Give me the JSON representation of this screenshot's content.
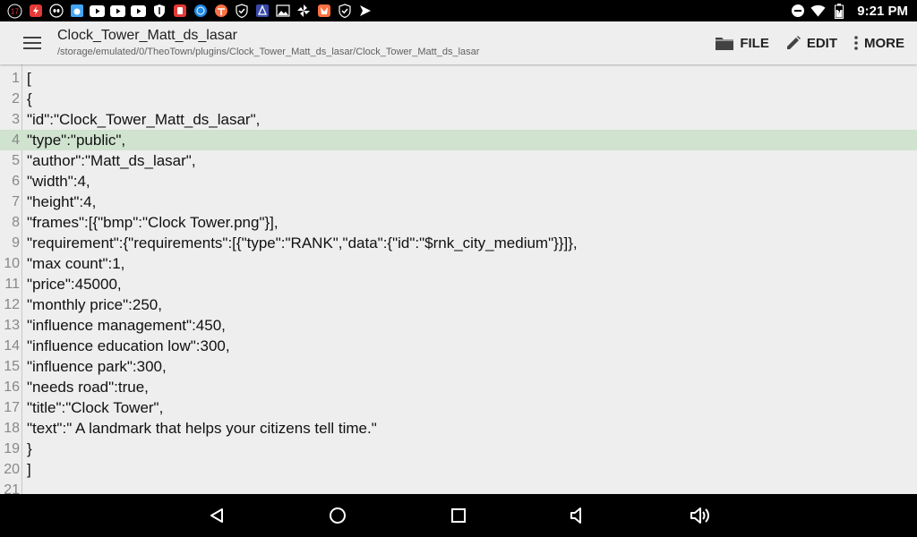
{
  "status_bar": {
    "notification_count": "17",
    "time": "9:21 PM",
    "left_icons": [
      "notification-count-icon",
      "flash-icon",
      "alien-icon",
      "weather-icon",
      "youtube-icon",
      "youtube-icon",
      "youtube-icon",
      "shield-icon",
      "app-icon",
      "globe-icon",
      "vpn-icon",
      "check-shield-icon",
      "astro-icon",
      "image-icon",
      "pinwheel-icon",
      "fox-icon",
      "check-shield-icon",
      "send-icon"
    ],
    "right_icons": [
      "dnd-icon",
      "wifi-icon",
      "battery-icon"
    ]
  },
  "app_bar": {
    "title": "Clock_Tower_Matt_ds_lasar",
    "path": "/storage/emulated/0/TheoTown/plugins/Clock_Tower_Matt_ds_lasar/Clock_Tower_Matt_ds_lasar",
    "actions": {
      "file": "FILE",
      "edit": "EDIT",
      "more": "MORE"
    }
  },
  "editor": {
    "current_line": 4,
    "lines": [
      {
        "num": "1",
        "text": "["
      },
      {
        "num": "2",
        "text": "{"
      },
      {
        "num": "3",
        "text": "\"id\":\"Clock_Tower_Matt_ds_lasar\","
      },
      {
        "num": "4",
        "text": "\"type\":\"public\","
      },
      {
        "num": "5",
        "text": "\"author\":\"Matt_ds_lasar\","
      },
      {
        "num": "6",
        "text": "\"width\":4,"
      },
      {
        "num": "7",
        "text": "\"height\":4,"
      },
      {
        "num": "8",
        "text": "\"frames\":[{\"bmp\":\"Clock Tower.png\"}],"
      },
      {
        "num": "9",
        "text": "\"requirement\":{\"requirements\":[{\"type\":\"RANK\",\"data\":{\"id\":\"$rnk_city_medium\"}}]},"
      },
      {
        "num": "10",
        "text": "\"max count\":1,"
      },
      {
        "num": "11",
        "text": "\"price\":45000,"
      },
      {
        "num": "12",
        "text": "\"monthly price\":250,"
      },
      {
        "num": "13",
        "text": "\"influence management\":450,"
      },
      {
        "num": "14",
        "text": "\"influence education low\":300,"
      },
      {
        "num": "15",
        "text": "\"influence park\":300,"
      },
      {
        "num": "16",
        "text": "\"needs road\":true,"
      },
      {
        "num": "17",
        "text": "\"title\":\"Clock Tower\","
      },
      {
        "num": "18",
        "text": "\"text\":\" A landmark that helps your citizens tell time.\""
      },
      {
        "num": "19",
        "text": "}"
      },
      {
        "num": "20",
        "text": "]"
      },
      {
        "num": "21",
        "text": ""
      }
    ]
  },
  "nav_bar": {
    "buttons": [
      "back-icon",
      "home-icon",
      "recents-icon",
      "volume-down-icon",
      "volume-up-icon"
    ]
  },
  "colors": {
    "current_line": "#cfe3cf",
    "background": "#eeeeee",
    "status_bar": "#000000"
  }
}
